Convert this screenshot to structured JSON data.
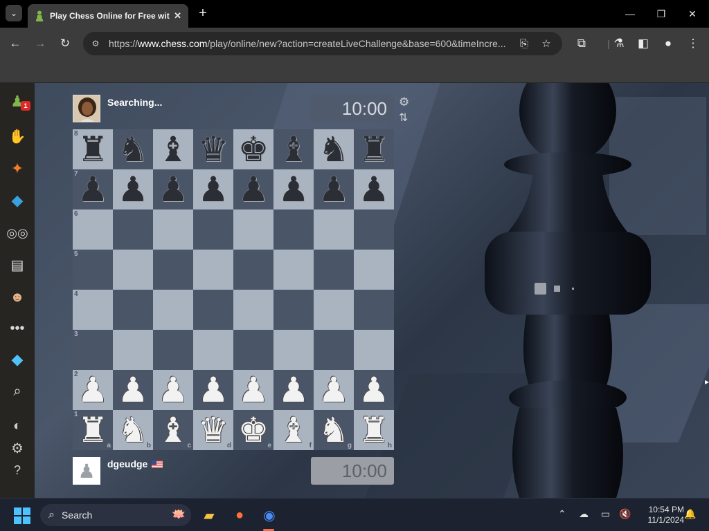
{
  "browser": {
    "tab_title": "Play Chess Online for Free with",
    "url_prefix": "https://",
    "url_domain": "www.chess.com",
    "url_path": "/play/online/new?action=createLiveChallenge&base=600&timeIncre..."
  },
  "sidebar": {
    "notification_count": "1"
  },
  "players": {
    "top": {
      "name": "Searching...",
      "clock": "10:00"
    },
    "bottom": {
      "name": "dgeudge",
      "clock": "10:00"
    }
  },
  "board": {
    "ranks": [
      "8",
      "7",
      "6",
      "5",
      "4",
      "3",
      "2",
      "1"
    ],
    "files": [
      "a",
      "b",
      "c",
      "d",
      "e",
      "f",
      "g",
      "h"
    ],
    "position": [
      [
        "r",
        "n",
        "b",
        "q",
        "k",
        "b",
        "n",
        "r"
      ],
      [
        "p",
        "p",
        "p",
        "p",
        "p",
        "p",
        "p",
        "p"
      ],
      [
        "",
        "",
        "",
        "",
        "",
        "",
        "",
        ""
      ],
      [
        "",
        "",
        "",
        "",
        "",
        "",
        "",
        ""
      ],
      [
        "",
        "",
        "",
        "",
        "",
        "",
        "",
        ""
      ],
      [
        "",
        "",
        "",
        "",
        "",
        "",
        "",
        ""
      ],
      [
        "P",
        "P",
        "P",
        "P",
        "P",
        "P",
        "P",
        "P"
      ],
      [
        "R",
        "N",
        "B",
        "Q",
        "K",
        "B",
        "N",
        "R"
      ]
    ],
    "colors": {
      "light": "#aab4c1",
      "dark": "#4b5568"
    }
  },
  "taskbar": {
    "search_label": "Search",
    "time": "10:54 PM",
    "date": "11/1/2024"
  },
  "icons": {
    "sidebar": [
      "chess-pawn-icon",
      "play-hand-icon",
      "puzzle-icon",
      "learn-icon",
      "watch-binoculars-icon",
      "news-icon",
      "social-icon",
      "more-icon",
      "diamond-icon",
      "search-icon",
      "theme-icon",
      "settings-icon",
      "help-icon"
    ]
  }
}
